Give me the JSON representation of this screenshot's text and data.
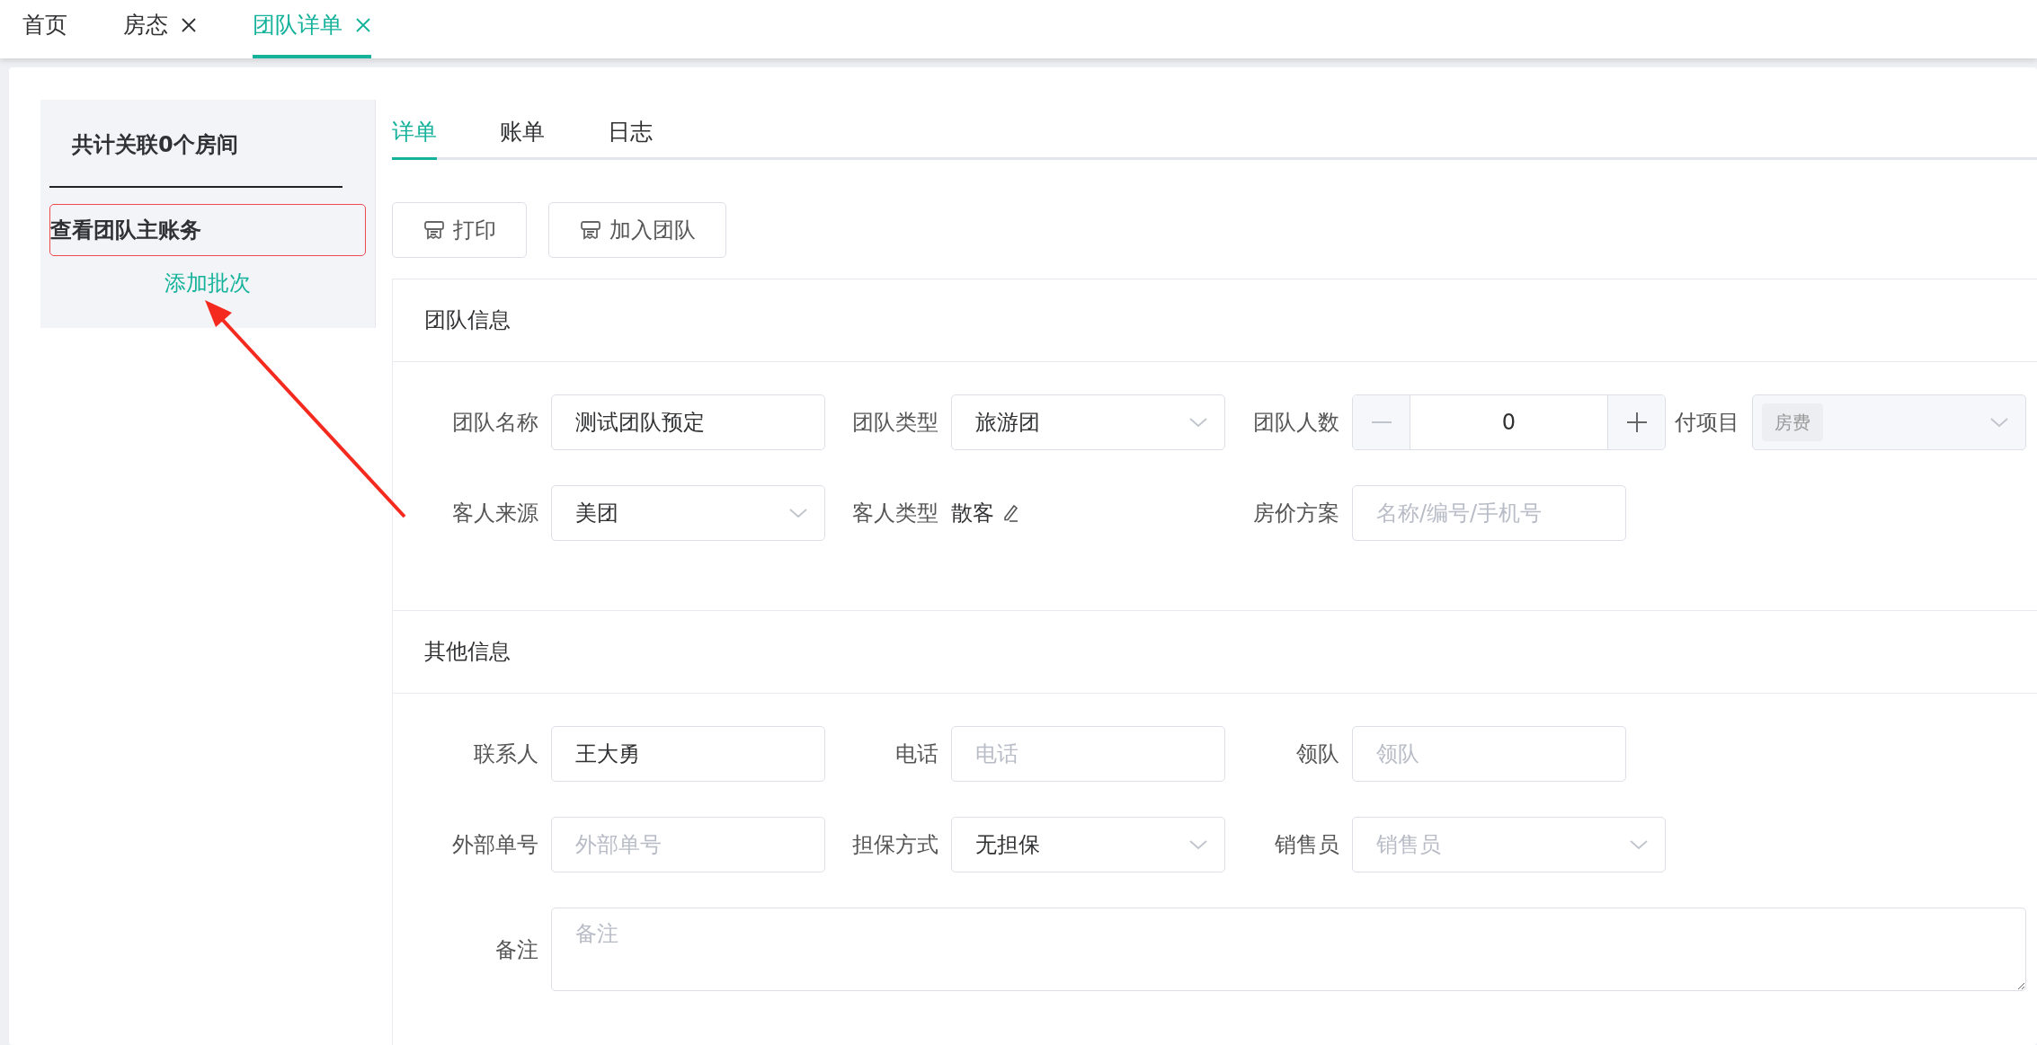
{
  "tabs": [
    {
      "label": "首页",
      "closable": false,
      "selected": false
    },
    {
      "label": "房态",
      "closable": true,
      "selected": false
    },
    {
      "label": "团队详单",
      "closable": true,
      "selected": true
    }
  ],
  "sidebar": {
    "title": "共计关联0个房间",
    "main_account": "查看团队主账务",
    "add_batch_link": "添加批次"
  },
  "subtabs": [
    {
      "label": "详单",
      "selected": true
    },
    {
      "label": "账单",
      "selected": false
    },
    {
      "label": "日志",
      "selected": false
    }
  ],
  "buttons": [
    {
      "label": "打印"
    },
    {
      "label": "加入团队"
    }
  ],
  "sections": [
    {
      "title": "团队信息",
      "rows": [
        [
          {
            "kind": "text",
            "label": "团队名称",
            "value": "测试团队预定"
          },
          {
            "kind": "select",
            "label": "团队类型",
            "value": "旅游团"
          },
          {
            "kind": "stepper",
            "label": "团队人数",
            "value": "0"
          },
          {
            "kind": "tag-select",
            "label": "付项目",
            "tags": [
              "房费"
            ],
            "disabled": true
          }
        ],
        [
          {
            "kind": "select",
            "label": "客人来源",
            "value": "美团"
          },
          {
            "kind": "static",
            "label": "客人类型",
            "value": "散客"
          },
          {
            "kind": "text",
            "label": "房价方案",
            "placeholder": "名称/编号/手机号"
          }
        ]
      ]
    },
    {
      "title": "其他信息",
      "rows": [
        [
          {
            "kind": "text",
            "label": "联系人",
            "value": "王大勇"
          },
          {
            "kind": "text",
            "label": "电话",
            "placeholder": "电话"
          },
          {
            "kind": "text",
            "label": "领队",
            "placeholder": "领队"
          }
        ],
        [
          {
            "kind": "text",
            "label": "外部单号",
            "placeholder": "外部单号"
          },
          {
            "kind": "select",
            "label": "担保方式",
            "value": "无担保"
          },
          {
            "kind": "select",
            "label": "销售员",
            "placeholder": "销售员"
          }
        ],
        [
          {
            "kind": "textarea",
            "label": "备注",
            "placeholder": "备注"
          }
        ]
      ]
    }
  ]
}
